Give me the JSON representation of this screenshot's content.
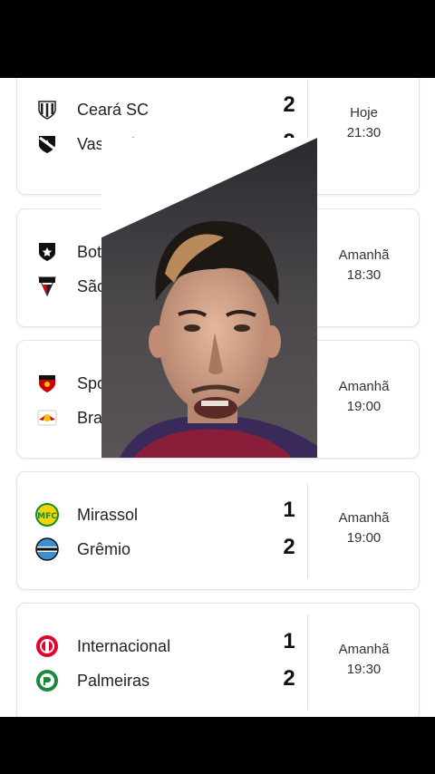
{
  "matches": [
    {
      "home": {
        "name": "Ceará SC",
        "score": "2"
      },
      "away": {
        "name": "Vasco da Gama",
        "score": "2"
      },
      "day": "Hoje",
      "time": "21:30"
    },
    {
      "home": {
        "name": "Botafogo",
        "score": ""
      },
      "away": {
        "name": "São Paulo",
        "score": ""
      },
      "day": "Amanhã",
      "time": "18:30"
    },
    {
      "home": {
        "name": "Sport Recife",
        "score": ""
      },
      "away": {
        "name": "Bragantino",
        "score": ""
      },
      "day": "Amanhã",
      "time": "19:00"
    },
    {
      "home": {
        "name": "Mirassol",
        "score": "1"
      },
      "away": {
        "name": "Grêmio",
        "score": "2"
      },
      "day": "Amanhã",
      "time": "19:00"
    },
    {
      "home": {
        "name": "Internacional",
        "score": "1"
      },
      "away": {
        "name": "Palmeiras",
        "score": "2"
      },
      "day": "Amanhã",
      "time": "19:30"
    }
  ],
  "crests": {
    "ceara": "ceara-crest-icon",
    "vasco": "vasco-crest-icon",
    "botafogo": "botafogo-crest-icon",
    "saopaulo": "sao-paulo-crest-icon",
    "sport": "sport-crest-icon",
    "bragantino": "bragantino-crest-icon",
    "mirassol": "mirassol-crest-icon",
    "gremio": "gremio-crest-icon",
    "internacional": "internacional-crest-icon",
    "palmeiras": "palmeiras-crest-icon"
  },
  "colors": {
    "background": "#000000",
    "card": "#ffffff",
    "text": "#222222"
  }
}
